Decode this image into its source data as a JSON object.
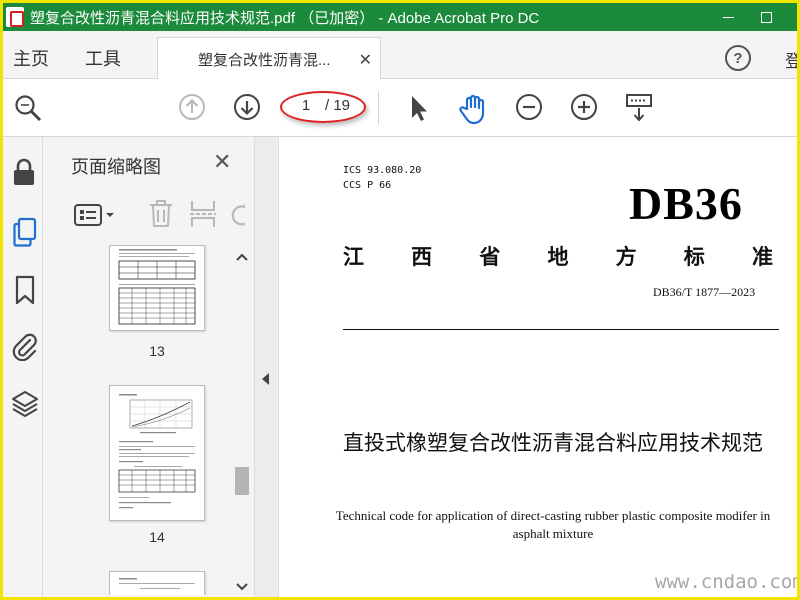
{
  "window": {
    "title": "塑复合改性沥青混合料应用技术规范.pdf （已加密） - Adobe Acrobat Pro DC"
  },
  "tabs": {
    "home": "主页",
    "tools": "工具",
    "document": "塑复合改性沥青混...",
    "signin": "登"
  },
  "toolbar": {
    "page_current": "1",
    "page_total": "/ 19",
    "accent_color": "#1f6fd1",
    "highlight_color": "#dd2222"
  },
  "sidebar": {
    "panel_title": "页面缩略图",
    "thumbnails": [
      {
        "label": "13"
      },
      {
        "label": "14"
      }
    ]
  },
  "document": {
    "ics": "ICS 93.080.20",
    "ccs": "CCS P 66",
    "db_code": "DB36",
    "province_chars": [
      "江",
      "西",
      "省",
      "地",
      "方",
      "标",
      "准"
    ],
    "standard_number": "DB36/T 1877—2023",
    "title_cn": "直投式橡塑复合改性沥青混合料应用技术规范",
    "title_en": "Technical code for application of direct-casting rubber plastic composite modifer in asphalt mixture"
  },
  "watermark": {
    "text": "www.cndao.com"
  }
}
